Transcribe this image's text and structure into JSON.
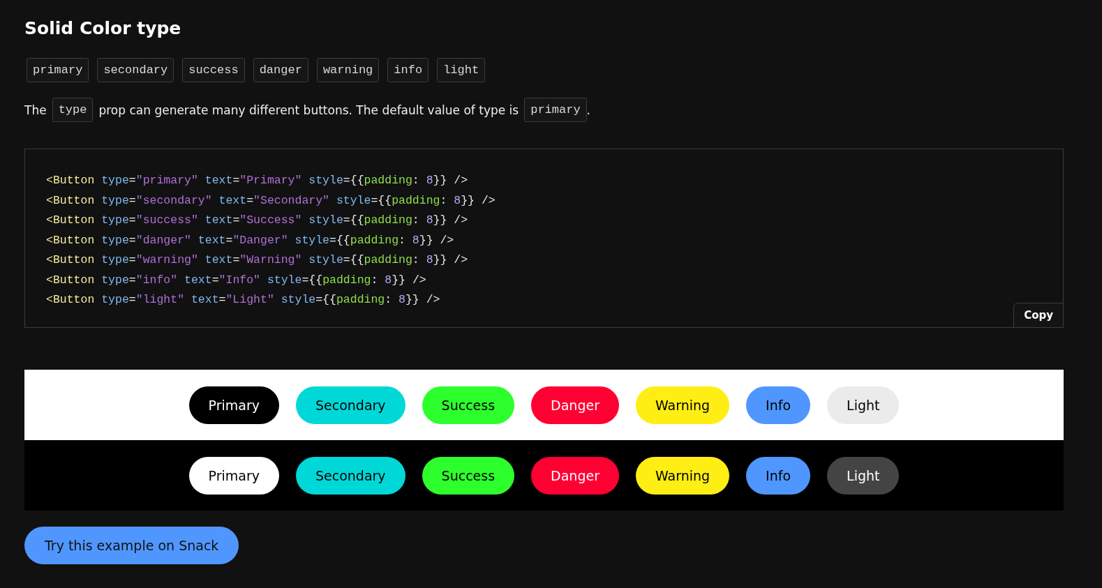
{
  "title": "Solid Color type",
  "type_chips": [
    "primary",
    "secondary",
    "success",
    "danger",
    "warning",
    "info",
    "light"
  ],
  "description": [
    {
      "kind": "text",
      "text": "The"
    },
    {
      "kind": "code",
      "text": "type"
    },
    {
      "kind": "text",
      "text": "prop can generate many different buttons. The default value of type is"
    },
    {
      "kind": "code",
      "text": "primary"
    },
    {
      "kind": "text",
      "text": "."
    }
  ],
  "code_lines": [
    [
      {
        "kind": "tag",
        "text": "<Button"
      },
      {
        "kind": "attr",
        "text": " type"
      },
      {
        "kind": "plain",
        "text": "="
      },
      {
        "kind": "string",
        "text": "\"primary\""
      },
      {
        "kind": "attr",
        "text": " text"
      },
      {
        "kind": "plain",
        "text": "="
      },
      {
        "kind": "string",
        "text": "\"Primary\""
      },
      {
        "kind": "attr",
        "text": " style"
      },
      {
        "kind": "plain",
        "text": "={{"
      },
      {
        "kind": "prop",
        "text": "padding"
      },
      {
        "kind": "plain",
        "text": ": "
      },
      {
        "kind": "number",
        "text": "8"
      },
      {
        "kind": "plain",
        "text": "}} />"
      }
    ],
    [
      {
        "kind": "tag",
        "text": "<Button"
      },
      {
        "kind": "attr",
        "text": " type"
      },
      {
        "kind": "plain",
        "text": "="
      },
      {
        "kind": "string",
        "text": "\"secondary\""
      },
      {
        "kind": "attr",
        "text": " text"
      },
      {
        "kind": "plain",
        "text": "="
      },
      {
        "kind": "string",
        "text": "\"Secondary\""
      },
      {
        "kind": "attr",
        "text": " style"
      },
      {
        "kind": "plain",
        "text": "={{"
      },
      {
        "kind": "prop",
        "text": "padding"
      },
      {
        "kind": "plain",
        "text": ": "
      },
      {
        "kind": "number",
        "text": "8"
      },
      {
        "kind": "plain",
        "text": "}} />"
      }
    ],
    [
      {
        "kind": "tag",
        "text": "<Button"
      },
      {
        "kind": "attr",
        "text": " type"
      },
      {
        "kind": "plain",
        "text": "="
      },
      {
        "kind": "string",
        "text": "\"success\""
      },
      {
        "kind": "attr",
        "text": " text"
      },
      {
        "kind": "plain",
        "text": "="
      },
      {
        "kind": "string",
        "text": "\"Success\""
      },
      {
        "kind": "attr",
        "text": " style"
      },
      {
        "kind": "plain",
        "text": "={{"
      },
      {
        "kind": "prop",
        "text": "padding"
      },
      {
        "kind": "plain",
        "text": ": "
      },
      {
        "kind": "number",
        "text": "8"
      },
      {
        "kind": "plain",
        "text": "}} />"
      }
    ],
    [
      {
        "kind": "tag",
        "text": "<Button"
      },
      {
        "kind": "attr",
        "text": " type"
      },
      {
        "kind": "plain",
        "text": "="
      },
      {
        "kind": "string",
        "text": "\"danger\""
      },
      {
        "kind": "attr",
        "text": " text"
      },
      {
        "kind": "plain",
        "text": "="
      },
      {
        "kind": "string",
        "text": "\"Danger\""
      },
      {
        "kind": "attr",
        "text": " style"
      },
      {
        "kind": "plain",
        "text": "={{"
      },
      {
        "kind": "prop",
        "text": "padding"
      },
      {
        "kind": "plain",
        "text": ": "
      },
      {
        "kind": "number",
        "text": "8"
      },
      {
        "kind": "plain",
        "text": "}} />"
      }
    ],
    [
      {
        "kind": "tag",
        "text": "<Button"
      },
      {
        "kind": "attr",
        "text": " type"
      },
      {
        "kind": "plain",
        "text": "="
      },
      {
        "kind": "string",
        "text": "\"warning\""
      },
      {
        "kind": "attr",
        "text": " text"
      },
      {
        "kind": "plain",
        "text": "="
      },
      {
        "kind": "string",
        "text": "\"Warning\""
      },
      {
        "kind": "attr",
        "text": " style"
      },
      {
        "kind": "plain",
        "text": "={{"
      },
      {
        "kind": "prop",
        "text": "padding"
      },
      {
        "kind": "plain",
        "text": ": "
      },
      {
        "kind": "number",
        "text": "8"
      },
      {
        "kind": "plain",
        "text": "}} />"
      }
    ],
    [
      {
        "kind": "tag",
        "text": "<Button"
      },
      {
        "kind": "attr",
        "text": " type"
      },
      {
        "kind": "plain",
        "text": "="
      },
      {
        "kind": "string",
        "text": "\"info\""
      },
      {
        "kind": "attr",
        "text": " text"
      },
      {
        "kind": "plain",
        "text": "="
      },
      {
        "kind": "string",
        "text": "\"Info\""
      },
      {
        "kind": "attr",
        "text": " style"
      },
      {
        "kind": "plain",
        "text": "={{"
      },
      {
        "kind": "prop",
        "text": "padding"
      },
      {
        "kind": "plain",
        "text": ": "
      },
      {
        "kind": "number",
        "text": "8"
      },
      {
        "kind": "plain",
        "text": "}} />"
      }
    ],
    [
      {
        "kind": "tag",
        "text": "<Button"
      },
      {
        "kind": "attr",
        "text": " type"
      },
      {
        "kind": "plain",
        "text": "="
      },
      {
        "kind": "string",
        "text": "\"light\""
      },
      {
        "kind": "attr",
        "text": " text"
      },
      {
        "kind": "plain",
        "text": "="
      },
      {
        "kind": "string",
        "text": "\"Light\""
      },
      {
        "kind": "attr",
        "text": " style"
      },
      {
        "kind": "plain",
        "text": "={{"
      },
      {
        "kind": "prop",
        "text": "padding"
      },
      {
        "kind": "plain",
        "text": ": "
      },
      {
        "kind": "number",
        "text": "8"
      },
      {
        "kind": "plain",
        "text": "}} />"
      }
    ]
  ],
  "copy_button": "Copy",
  "previews": [
    {
      "kind": "light",
      "buttons": [
        {
          "label": "Primary",
          "color": "#000000"
        },
        {
          "label": "Secondary",
          "color": "#00d8d8"
        },
        {
          "label": "Success",
          "color": "#2cff2c"
        },
        {
          "label": "Danger",
          "color": "#ff0033"
        },
        {
          "label": "Warning",
          "color": "#ffee14"
        },
        {
          "label": "Info",
          "color": "#4f97ff"
        },
        {
          "label": "Light",
          "color": "#ebebeb"
        }
      ]
    },
    {
      "kind": "dark",
      "buttons": [
        {
          "label": "Primary",
          "color": "#ffffff"
        },
        {
          "label": "Secondary",
          "color": "#00d8d8"
        },
        {
          "label": "Success",
          "color": "#2cff2c"
        },
        {
          "label": "Danger",
          "color": "#ff0033"
        },
        {
          "label": "Warning",
          "color": "#ffee14"
        },
        {
          "label": "Info",
          "color": "#4f97ff"
        },
        {
          "label": "Light",
          "color": "#444444"
        }
      ]
    }
  ],
  "snack_button": "Try this example on Snack"
}
